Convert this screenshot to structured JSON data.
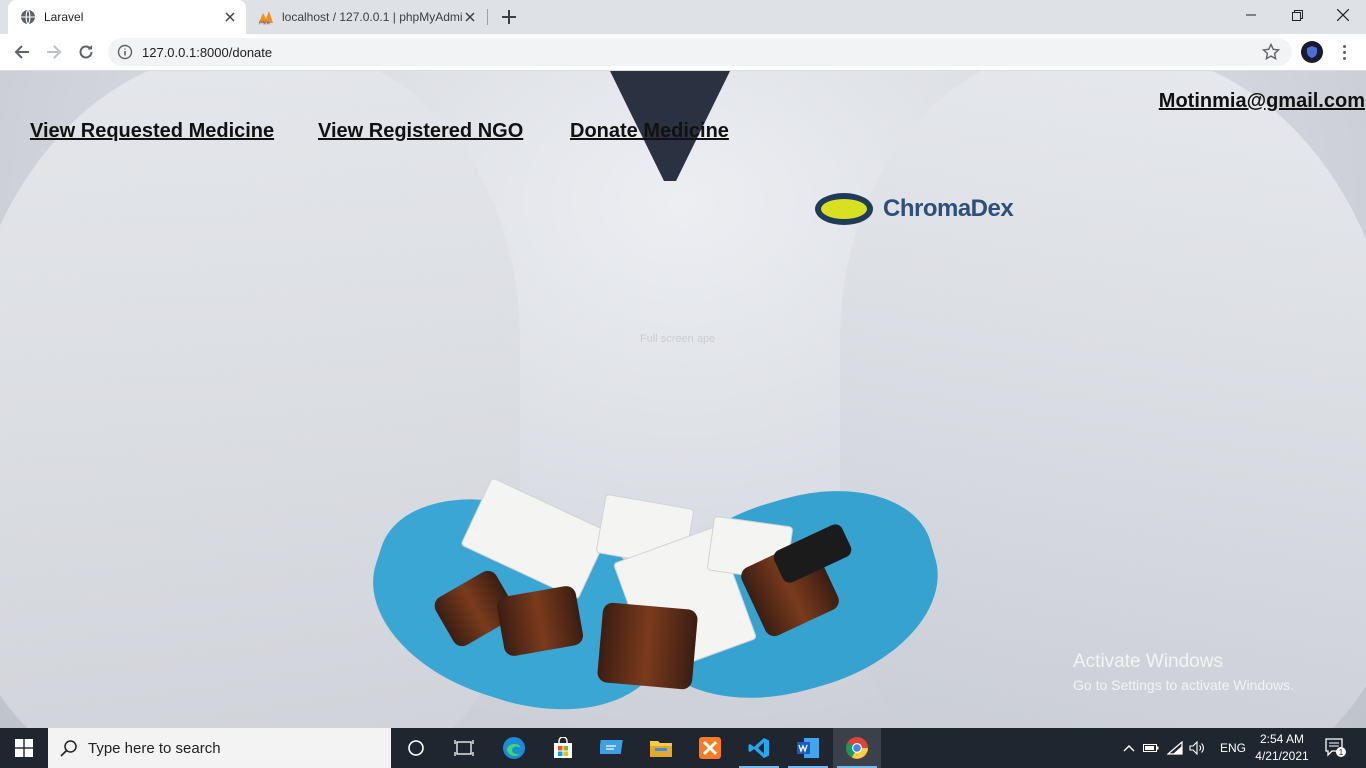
{
  "browser": {
    "tabs": [
      {
        "title": "Laravel",
        "active": true
      },
      {
        "title": "localhost / 127.0.0.1 | phpMyAdmin",
        "active": false
      }
    ],
    "url": "127.0.0.1:8000/donate"
  },
  "page": {
    "nav": [
      {
        "label": "View Requested Medicine"
      },
      {
        "label": "View Registered NGO"
      },
      {
        "label": "Donate Medicine"
      }
    ],
    "user_email": "Motinmia@gmail.com",
    "background_logo_text": "ChromaDex",
    "faint_text": "Full screen ape"
  },
  "watermark": {
    "title": "Activate Windows",
    "subtitle": "Go to Settings to activate Windows."
  },
  "taskbar": {
    "search_placeholder": "Type here to search",
    "language": "ENG",
    "time": "2:54 AM",
    "date": "4/21/2021",
    "notification_count": "1"
  },
  "colors": {
    "taskbar_bg": "#1f2630",
    "glove_blue": "#3aa6d3",
    "link_color": "#111111"
  }
}
